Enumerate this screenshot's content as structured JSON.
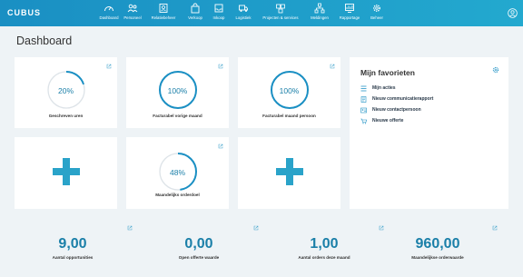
{
  "app": {
    "logo": "CUBUS"
  },
  "nav": [
    {
      "label": "Dashboard",
      "icon": "speedometer-icon"
    },
    {
      "label": "Personeel",
      "icon": "people-icon"
    },
    {
      "label": "Relatiebeheer",
      "icon": "address-book-icon"
    },
    {
      "label": "Verkoop",
      "icon": "shopping-bag-icon"
    },
    {
      "label": "Inkoop",
      "icon": "inbox-icon"
    },
    {
      "label": "Logistiek",
      "icon": "truck-icon"
    },
    {
      "label": "Projecten & services",
      "icon": "projects-icon"
    },
    {
      "label": "Meldingen",
      "icon": "network-icon"
    },
    {
      "label": "Rapportage",
      "icon": "report-icon"
    },
    {
      "label": "Beheer",
      "icon": "gear-icon"
    }
  ],
  "page": {
    "title": "Dashboard"
  },
  "kpis": [
    {
      "value": "20%",
      "label": "Geschreven uren",
      "progress": 0.2
    },
    {
      "value": "100%",
      "label": "Facturabel vorige maand",
      "progress": 1.0
    },
    {
      "value": "100%",
      "label": "Facturabel maand persoon",
      "progress": 1.0
    },
    {
      "value": "48%",
      "label": "Maandelijks orderdoel",
      "progress": 0.48
    }
  ],
  "favorites": {
    "title": "Mijn favorieten",
    "items": [
      {
        "label": "Mijn acties",
        "icon": "list-icon"
      },
      {
        "label": "Nieuw communicatierapport",
        "icon": "document-icon"
      },
      {
        "label": "Nieuw contactpersoon",
        "icon": "contact-card-icon"
      },
      {
        "label": "Nieuwe offerte",
        "icon": "cart-icon"
      }
    ]
  },
  "stats": [
    {
      "value": "9,00",
      "label": "Aantal opportunities"
    },
    {
      "value": "0,00",
      "label": "Open offerte waarde"
    },
    {
      "value": "1,00",
      "label": "Aantal orders deze maand"
    },
    {
      "value": "960,00",
      "label": "Maandelijkse orderwaarde"
    }
  ],
  "colors": {
    "accent": "#1a8fc3",
    "plus": "#2aa3c9",
    "ring_track": "#dde3e8"
  }
}
